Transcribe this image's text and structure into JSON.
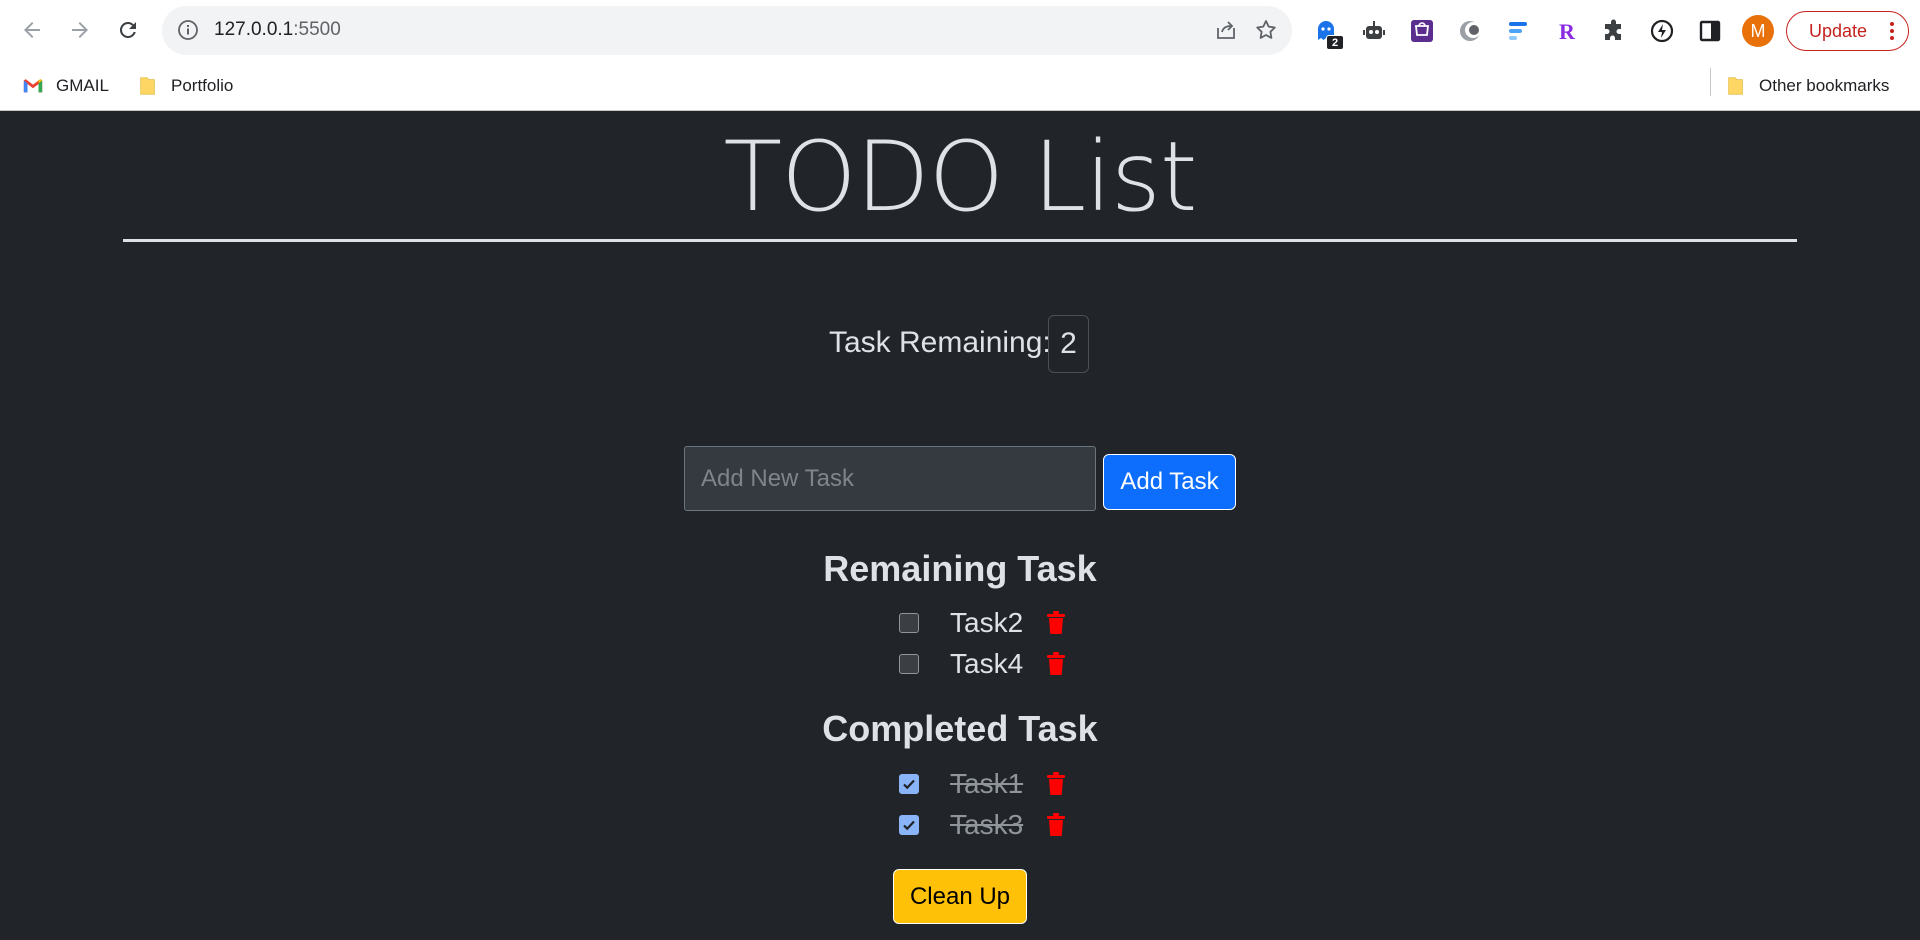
{
  "browser": {
    "url_host": "127.0.0.1",
    "url_port": ":5500",
    "extension_badge": "2",
    "avatar_letter": "M",
    "update_label": "Update",
    "bookmarks": [
      {
        "label": "GMAIL",
        "icon": "gmail-icon"
      },
      {
        "label": "Portfolio",
        "icon": "folder-icon"
      }
    ],
    "other_bookmarks": "Other bookmarks"
  },
  "app": {
    "title": "TODO List",
    "remaining_label": "Task Remaining:",
    "remaining_count": "2",
    "input_placeholder": "Add New Task",
    "add_button": "Add Task",
    "remaining_heading": "Remaining Task",
    "completed_heading": "Completed Task",
    "remaining_tasks": [
      {
        "name": "Task2",
        "checked": false
      },
      {
        "name": "Task4",
        "checked": false
      }
    ],
    "completed_tasks": [
      {
        "name": "Task1",
        "checked": true
      },
      {
        "name": "Task3",
        "checked": true
      }
    ],
    "cleanup_button": "Clean Up"
  },
  "colors": {
    "page_background": "#212529",
    "primary": "#0d6efd",
    "warning": "#ffc107",
    "delete": "#ff0000"
  }
}
